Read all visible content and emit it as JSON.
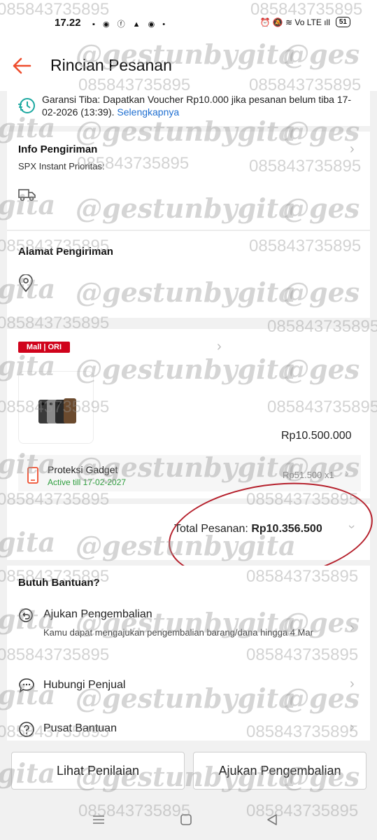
{
  "status_bar": {
    "time": "17.22",
    "left_icons": "▪ ◉ ⓕ ▲ ◉ •",
    "right_icons": "⏰ 🔕 ≋ Vo LTE ıll",
    "battery": "51"
  },
  "header": {
    "title": "Rincian Pesanan",
    "accent_color": "#ee4d2d"
  },
  "guarantee": {
    "text": "Garansi Tiba: Dapatkan Voucher Rp10.000 jika pesanan belum tiba 17-02-2026 (13:39).",
    "link": "Selengkapnya"
  },
  "shipping_info": {
    "title": "Info Pengiriman",
    "service": "SPX Instant Prioritas:"
  },
  "address": {
    "title": "Alamat Pengiriman"
  },
  "shop": {
    "badge": "Mall | ORI"
  },
  "product": {
    "price": "Rp10.500.000"
  },
  "protection": {
    "title": "Proteksi Gadget",
    "status": "Active till 17-02-2027",
    "price_qty": "Rp51.500 x1"
  },
  "order_total": {
    "label": "Total Pesanan:",
    "value": "Rp10.356.500"
  },
  "help": {
    "title": "Butuh Bantuan?",
    "items": [
      {
        "label": "Ajukan Pengembalian",
        "subtitle": "Kamu dapat mengajukan pengembalian barang/dana hingga 4 Mar",
        "icon": "return-icon"
      },
      {
        "label": "Hubungi Penjual",
        "icon": "chat-icon"
      },
      {
        "label": "Pusat Bantuan",
        "icon": "help-icon"
      }
    ]
  },
  "actions": {
    "review": "Lihat Penilaian",
    "return": "Ajukan Pengembalian"
  },
  "watermark": {
    "handle": "@gestunbygita",
    "phone": "085843735895",
    "short": "gita",
    "partial": "@ges"
  }
}
